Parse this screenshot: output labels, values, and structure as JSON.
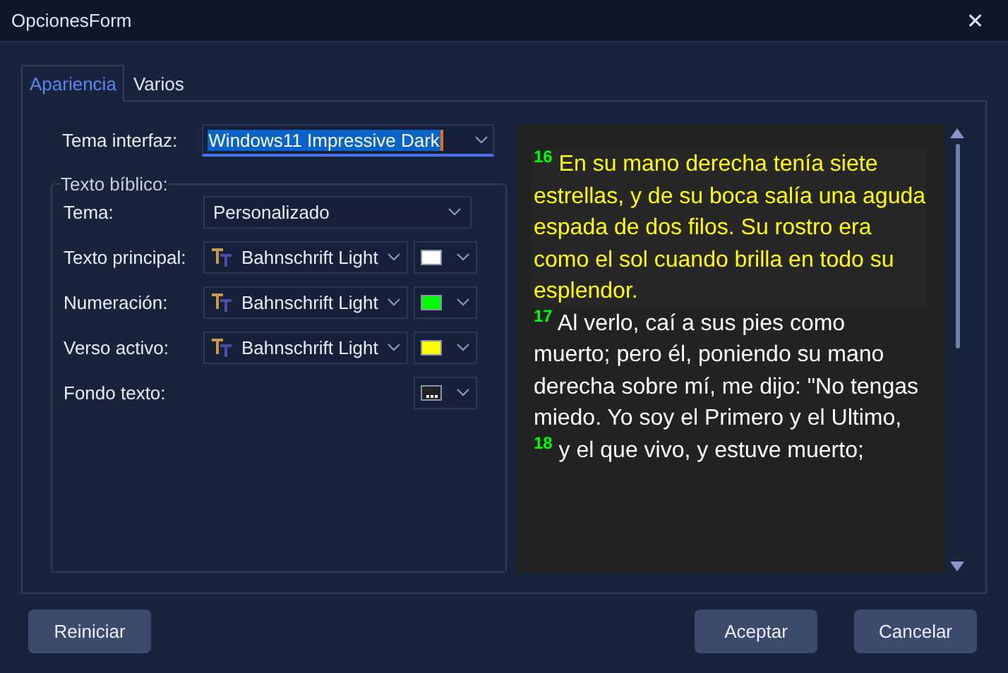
{
  "window": {
    "title": "OpcionesForm",
    "close": "✕"
  },
  "tabs": [
    {
      "label": "Apariencia",
      "selected": true
    },
    {
      "label": "Varios",
      "selected": false
    }
  ],
  "interface_theme": {
    "label": "Tema interfaz:",
    "value": "Windows11 Impressive Dark"
  },
  "bible_text": {
    "legend": "Texto bíblico:",
    "theme": {
      "label": "Tema:",
      "value": "Personalizado"
    },
    "rows": [
      {
        "kind": "font",
        "label": "Texto principal:",
        "font": "Bahnschrift Light",
        "color": "#ffffff"
      },
      {
        "kind": "font",
        "label": "Numeración:",
        "font": "Bahnschrift Light",
        "color": "#00ff00"
      },
      {
        "kind": "font",
        "label": "Verso activo:",
        "font": "Bahnschrift Light",
        "color": "#ffff00"
      },
      {
        "kind": "background",
        "label": "Fondo texto:",
        "color": "#222222"
      }
    ]
  },
  "preview": {
    "verses": [
      {
        "number": "16",
        "text": "En su mano derecha tenía siete estrellas, y de su boca salía una aguda espada de dos filos. Su rostro era como el sol cuando brilla en todo su esplendor.",
        "active": true
      },
      {
        "number": "17",
        "text": "Al verlo, caí a sus pies como muerto; pero él, poniendo su mano derecha sobre mí, me dijo: \"No tengas miedo. Yo soy el Primero y el Ultimo,",
        "active": false
      },
      {
        "number": "18",
        "text": "y el que vivo, y estuve muerto;",
        "active": false
      }
    ]
  },
  "buttons": [
    {
      "label": "Reiniciar"
    },
    {
      "label": "Aceptar"
    },
    {
      "label": "Cancelar"
    }
  ]
}
